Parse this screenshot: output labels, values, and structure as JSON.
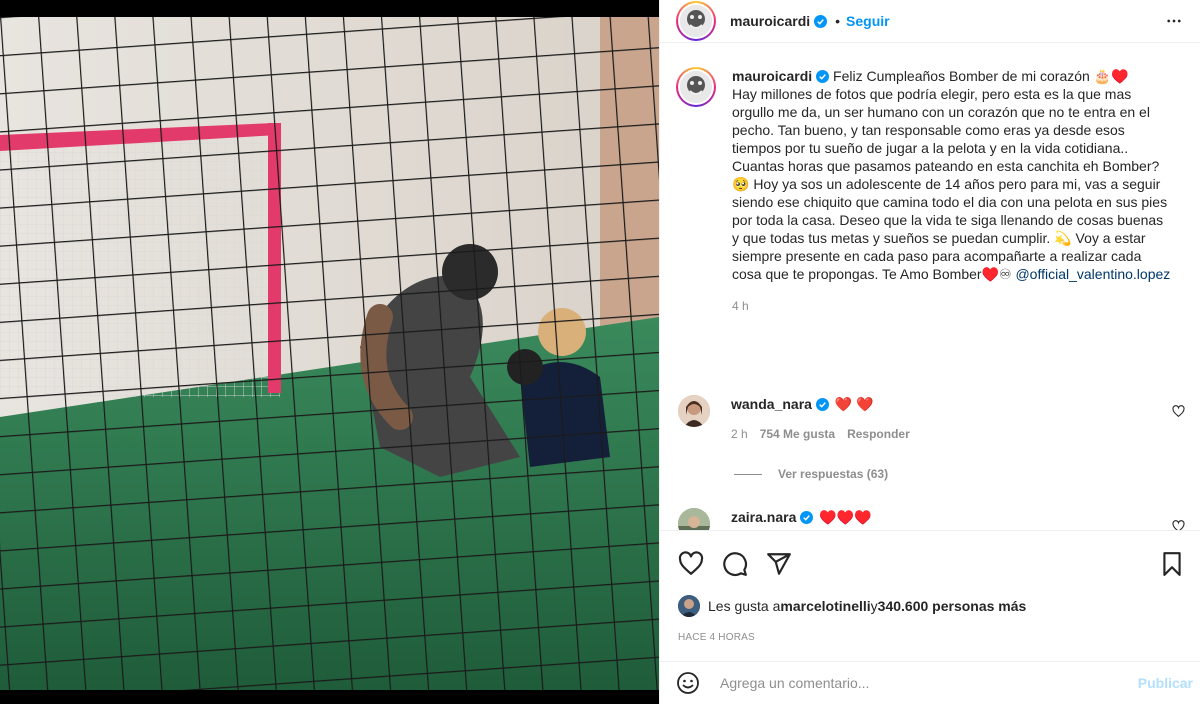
{
  "post": {
    "username": "mauroicardi",
    "follow_label": "Seguir",
    "dot": "•"
  },
  "caption": {
    "username": "mauroicardi",
    "text": "Feliz Cumpleaños Bomber de mi corazón 🎂♥️\nHay millones de fotos que podría elegir, pero esta es la que mas orgullo me da, un ser humano con un corazón que no te entra en el pecho. Tan bueno, y tan responsable como eras ya desde esos tiempos por tu sueño de jugar a la pelota y en la vida cotidiana..\nCuantas horas que pasamos pateando en esta canchita eh Bomber? 🥺 Hoy ya sos un adolescente de 14 años pero para mi, vas a seguir siendo ese chiquito que camina todo el dia con una pelota en sus pies por toda la casa. Deseo que la vida te siga llenando de cosas buenas y que todas tus metas y sueños se puedan cumplir. 💫 Voy a estar siempre presente en cada paso para acompañarte a realizar cada cosa que te propongas. Te Amo Bomber♥️♾ ",
    "mention": "@official_valentino.lopez",
    "time": "4 h"
  },
  "comments": [
    {
      "username": "wanda_nara",
      "text": "❤️ ❤️",
      "time": "2 h",
      "likes": "754 Me gusta",
      "reply": "Responder",
      "view_replies": "Ver respuestas (63)"
    },
    {
      "username": "zaira.nara",
      "text": "♥️♥️♥️"
    }
  ],
  "likes": {
    "prefix": "Les gusta a ",
    "user": "marcelotinelli",
    "middle": " y ",
    "count": "340.600 personas más"
  },
  "time_ago": "HACE 4 HORAS",
  "add_comment": {
    "placeholder": "Agrega un comentario...",
    "publish": "Publicar"
  },
  "colors": {
    "accent": "#0095f6",
    "heart": "#ed4956",
    "publish_disabled": "#b2dffc",
    "muted": "#8e8e8e"
  },
  "icons": [
    "more-options-icon",
    "verified-badge-icon",
    "heart-icon",
    "comment-icon",
    "share-icon",
    "bookmark-icon",
    "emoji-icon"
  ]
}
